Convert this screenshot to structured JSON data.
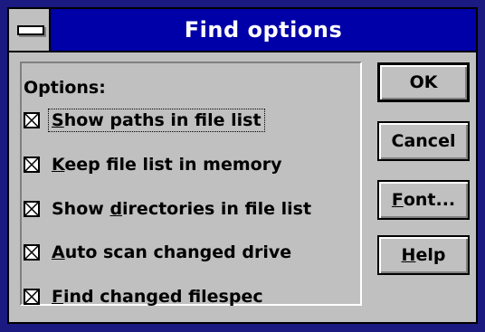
{
  "window": {
    "title": "Find options"
  },
  "options": {
    "group_label": "Options:",
    "items": [
      {
        "pre": "",
        "key": "S",
        "post": "how paths in file list",
        "checked": true
      },
      {
        "pre": "",
        "key": "K",
        "post": "eep file list in memory",
        "checked": true
      },
      {
        "pre": "Show ",
        "key": "d",
        "post": "irectories in file list",
        "checked": true
      },
      {
        "pre": "",
        "key": "A",
        "post": "uto scan changed drive",
        "checked": true
      },
      {
        "pre": "",
        "key": "F",
        "post": "ind changed filespec",
        "checked": true
      }
    ]
  },
  "buttons": {
    "ok": {
      "label": "OK"
    },
    "cancel": {
      "label": "Cancel"
    },
    "font": {
      "pre": "",
      "key": "F",
      "post": "ont..."
    },
    "help": {
      "pre": "",
      "key": "H",
      "post": "elp"
    }
  },
  "icons": {
    "system_menu": "system-menu-icon",
    "checkbox_mark": "x-mark-icon"
  },
  "colors": {
    "title_bar": "#0000a8",
    "dialog_face": "#c0c0c0",
    "outer_frame": "#1a1a80"
  }
}
